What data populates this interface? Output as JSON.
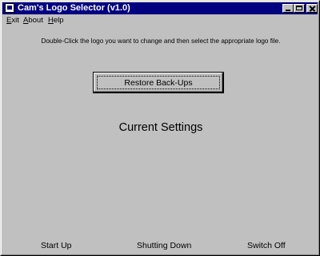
{
  "window": {
    "title": "Cam's Logo Selector (v1.0)",
    "titlebar_color": "#000080",
    "background_color": "#c0c0c0"
  },
  "menu": {
    "exit": {
      "first": "E",
      "rest": "xit"
    },
    "about": {
      "first": "A",
      "rest": "bout"
    },
    "help": {
      "first": "H",
      "rest": "elp"
    }
  },
  "instruction": "Double-Click the logo you want to change and then select the appropriate logo file.",
  "restore_button": "Restore Back-Ups",
  "current_settings": "Current Settings",
  "logo_slots": {
    "start_up": "Start Up",
    "shutting_down": "Shutting Down",
    "switch_off": "Switch Off"
  },
  "icons": {
    "app": "application-window-icon",
    "minimize": "minimize-icon",
    "maximize": "maximize-icon",
    "close": "close-icon"
  }
}
